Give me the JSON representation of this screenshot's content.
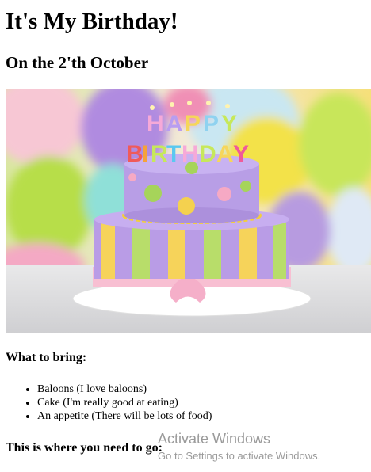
{
  "page": {
    "title": "It's My Birthday!",
    "subtitle": "On the 2'th October"
  },
  "hero_image": {
    "alt": "",
    "candle_lettering": "HAPPY BIRTHDAY"
  },
  "bring_section": {
    "heading": "What to bring:",
    "items": [
      "Baloons (I love baloons)",
      "Cake (I'm really good at eating)",
      "An appetite (There will be lots of food)"
    ]
  },
  "location_section": {
    "heading": "This is where you need to go:"
  },
  "watermark": {
    "title": "Activate Windows",
    "subtitle": "Go to Settings to activate Windows."
  },
  "colors": {
    "text": "#000000",
    "watermark": "#787878"
  }
}
